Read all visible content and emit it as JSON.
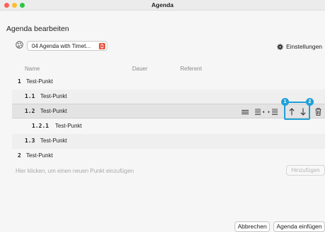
{
  "window": {
    "title": "Agenda"
  },
  "heading": "Agenda bearbeiten",
  "template_select": {
    "value": "04 Agenda with Timet..."
  },
  "settings_label": "Einstellungen",
  "columns": {
    "name": "Name",
    "duration": "Dauer",
    "presenter": "Referent"
  },
  "rows": [
    {
      "num": "1",
      "label": "Test-Punkt"
    },
    {
      "num": "1.1",
      "label": "Test-Punkt"
    },
    {
      "num": "1.2",
      "label": "Test-Punkt"
    },
    {
      "num": "1.2.1",
      "label": "Test-Punkt"
    },
    {
      "num": "1.3",
      "label": "Test-Punkt"
    },
    {
      "num": "2",
      "label": "Test-Punkt"
    }
  ],
  "add_placeholder": "Hier klicken, um einen neuen Punkt einzufügen",
  "add_button": "Hinzufügen",
  "callouts": [
    "1",
    "2"
  ],
  "footer": {
    "cancel": "Abbrechen",
    "insert": "Agenda einfügen"
  },
  "colors": {
    "accent": "#1f9fd6",
    "close": "#fe5f57",
    "minimize": "#febc2e",
    "maximize": "#28c840"
  }
}
